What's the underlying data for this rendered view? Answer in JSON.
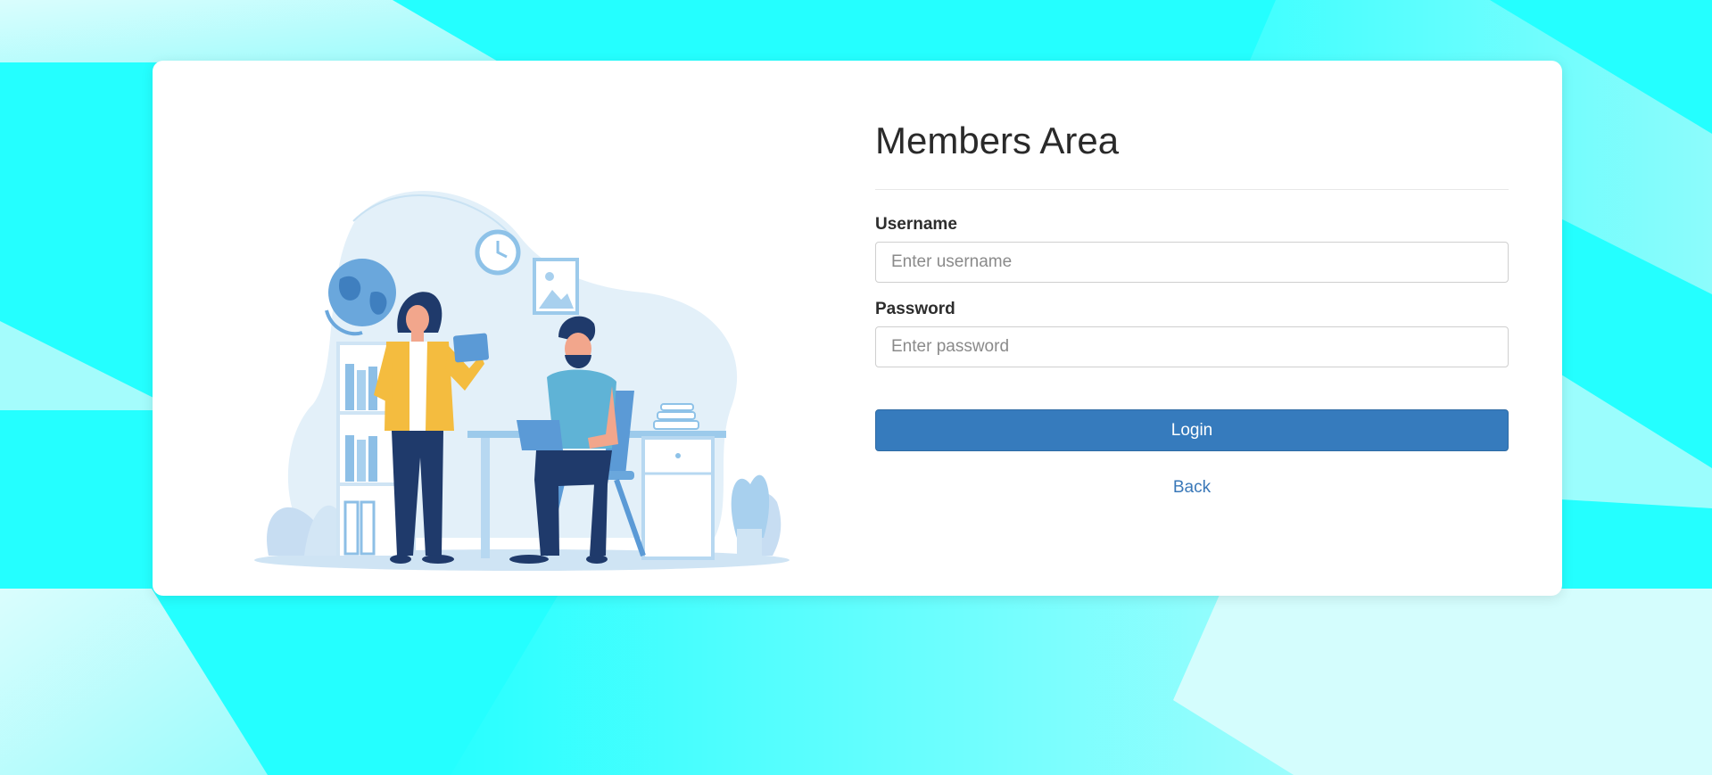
{
  "page": {
    "colors": {
      "background": "#24ffff",
      "card": "#ffffff",
      "primary_button": "#367bbd",
      "link": "#3a78b8"
    }
  },
  "login_form": {
    "title": "Members Area",
    "username": {
      "label": "Username",
      "placeholder": "Enter username",
      "value": ""
    },
    "password": {
      "label": "Password",
      "placeholder": "Enter password",
      "value": ""
    },
    "login_label": "Login",
    "back_label": "Back"
  },
  "illustration": {
    "icon": "office-team-illustration"
  }
}
